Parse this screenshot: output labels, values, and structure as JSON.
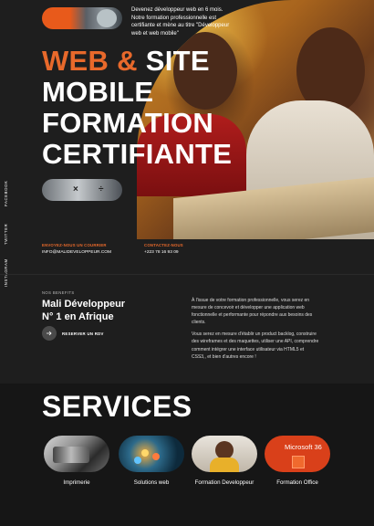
{
  "hero": {
    "description": "Devenez développeur web en 6 mois. Notre formation professionnelle est certifiante et mène au titre \"Développeur web et web mobile\"",
    "title_part1": "WEB &",
    "title_part2": "SITE",
    "title_line2": "MOBILE",
    "title_line3": "FORMATION",
    "title_line4": "CERTIFIANTE",
    "accent_color": "#e8692b"
  },
  "contacts": [
    {
      "label": "ENVOYEZ-NOUS UN COURRIER",
      "value": "INFO@MALIDEVELOPPEUR.COM"
    },
    {
      "label": "CONTACTEZ-NOUS",
      "value": "+223 78 16 93 09"
    }
  ],
  "social": {
    "facebook": "FACEBOOK",
    "twitter": "TWITTER",
    "instagram": "INSTAGRAM"
  },
  "about": {
    "eyebrow": "NOS BENEFITS",
    "title_line1": "Mali Développeur",
    "title_line2": "N° 1 en Afrique",
    "cta": "RESERVER UN RDV",
    "paragraph1": "À l'issue de votre formation professionnelle, vous serez en mesure de concevoir et développer une application web fonctionnelle et performante pour répondre aux besoins des clients.",
    "paragraph2": "Vous serez en mesure d'établir un product backlog, construire des wireframes et des maquettes, utiliser une API, comprendre comment intégrer une interface utilisateur via HTML5 et CSS3,, et bien d'autres encore !"
  },
  "services": {
    "title": "SERVICES",
    "items": [
      {
        "label": "Imprimerie",
        "icon": "printer-photo"
      },
      {
        "label": "Solutions web",
        "icon": "network-photo"
      },
      {
        "label": "Formation Developpeur",
        "icon": "developer-photo"
      },
      {
        "label": "Formation Office",
        "icon": "office-365-photo",
        "image_text": "Microsoft 36"
      }
    ]
  }
}
